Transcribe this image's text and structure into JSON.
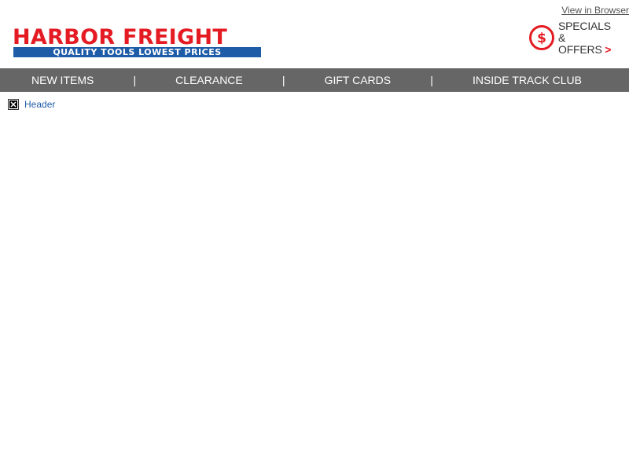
{
  "top_link": {
    "label": "View in Browser"
  },
  "logo": {
    "name": "HARBOR FREIGHT",
    "tagline": "QUALITY TOOLS   LOWEST PRICES",
    "colors": {
      "red": "#e41b23",
      "blue": "#1f5ca8"
    }
  },
  "specials": {
    "line1": "SPECIALS",
    "line2": "& OFFERS",
    "caret": ">",
    "icon": "dollar-circle-icon"
  },
  "nav": {
    "items": [
      {
        "label": "NEW ITEMS"
      },
      {
        "label": "CLEARANCE"
      },
      {
        "label": "GIFT CARDS"
      },
      {
        "label": "INSIDE TRACK CLUB"
      }
    ],
    "separator": "|",
    "background": "#666666"
  },
  "header_image": {
    "alt": "Header",
    "icon": "broken-image-icon"
  }
}
